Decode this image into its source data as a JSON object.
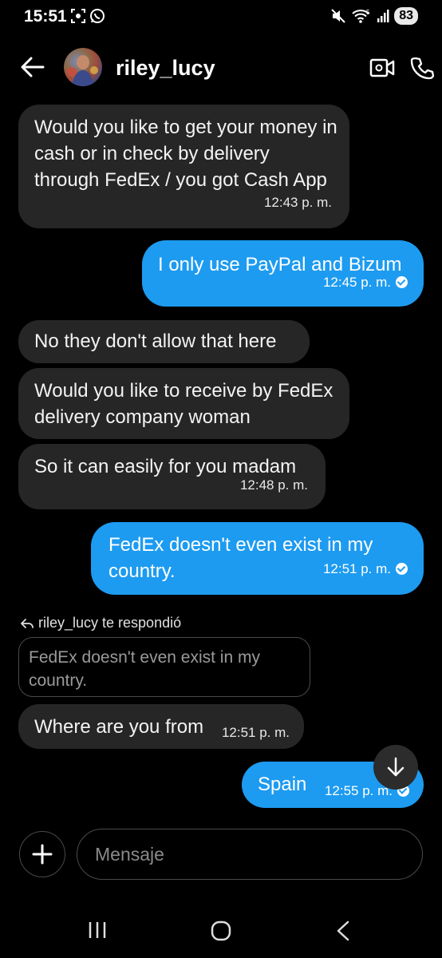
{
  "status_bar": {
    "time": "15:51",
    "battery": "83",
    "network": "5"
  },
  "header": {
    "username": "riley_lucy"
  },
  "messages": [
    {
      "text": "Would you like to get your money in cash or in check by delivery through FedEx / you got Cash App",
      "time": "12:43 p. m."
    },
    {
      "text": "I only use PayPal and Bizum",
      "time": "12:45 p. m."
    },
    {
      "text": "No they don't allow that here"
    },
    {
      "text": "Would you like to receive by FedEx delivery company woman"
    },
    {
      "text": "So it can easily for you madam",
      "time": "12:48 p. m."
    },
    {
      "text": "FedEx doesn't even exist in my country.",
      "time": "12:51 p. m."
    },
    {
      "text": "Where are you from",
      "time": "12:51 p. m."
    },
    {
      "text": "Spain",
      "time": "12:55 p. m."
    }
  ],
  "reply": {
    "label": "riley_lucy te respondió",
    "quoted_text": "FedEx doesn't even exist in my country."
  },
  "composer": {
    "placeholder": "Mensaje"
  },
  "colors": {
    "outgoing_bubble": "#1d9bf0",
    "incoming_bubble": "#262626",
    "background": "#000000"
  },
  "icons": [
    "back-arrow-icon",
    "video-call-icon",
    "phone-icon",
    "scroll-down-icon",
    "plus-icon",
    "recents-icon",
    "home-icon",
    "back-nav-icon"
  ]
}
